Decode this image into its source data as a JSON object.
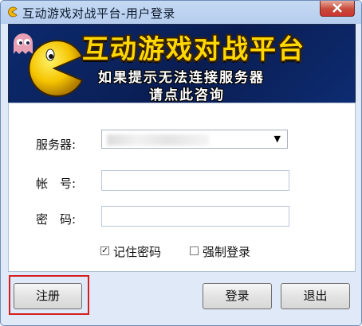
{
  "window": {
    "title": "互动游戏对战平台-用户登录",
    "icon": "pacman-icon",
    "close_icon": "close-icon"
  },
  "banner": {
    "title": "互动游戏对战平台",
    "line1": "如果提示无法连接服务器",
    "line2": "请点此咨询",
    "colors": {
      "title": "#ffd800",
      "background": "#0c2a6e"
    }
  },
  "form": {
    "server_label": "服务器:",
    "server_value": "",
    "account_label": "帐　号:",
    "account_value": "",
    "password_label": "密　码:",
    "password_value": "",
    "remember_label": "记住密码",
    "remember_checked": true,
    "force_label": "强制登录",
    "force_checked": false
  },
  "buttons": {
    "register": "注册",
    "login": "登录",
    "exit": "退出"
  },
  "colors": {
    "highlight": "#d61f1f",
    "window_bg": "#dfe9f7"
  }
}
